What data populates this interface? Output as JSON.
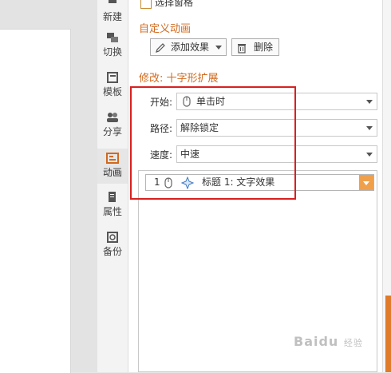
{
  "top_partial": {
    "label": "选择窗格"
  },
  "tabs": [
    {
      "id": "new",
      "label": "新建",
      "icon": "new-slide-icon"
    },
    {
      "id": "switch",
      "label": "切换",
      "icon": "transition-icon"
    },
    {
      "id": "template",
      "label": "模板",
      "icon": "template-icon"
    },
    {
      "id": "share",
      "label": "分享",
      "icon": "share-icon"
    },
    {
      "id": "animation",
      "label": "动画",
      "icon": "animation-icon",
      "active": true
    },
    {
      "id": "property",
      "label": "属性",
      "icon": "property-icon"
    },
    {
      "id": "backup",
      "label": "备份",
      "icon": "backup-icon"
    }
  ],
  "custom_animation": {
    "title": "自定义动画",
    "add_effect_label": "添加效果",
    "delete_label": "删除"
  },
  "modify": {
    "title": "修改: 十字形扩展",
    "start_label": "开始:",
    "start_value": "单击时",
    "path_label": "路径:",
    "path_value": "解除锁定",
    "speed_label": "速度:",
    "speed_value": "中速"
  },
  "animation_list": [
    {
      "index": "1",
      "name": "标题 1: 文字效果"
    }
  ],
  "watermark": {
    "brand": "Baidu",
    "sub": "经验"
  },
  "colors": {
    "accent": "#d2691e",
    "highlight": "#d92020",
    "dropdown": "#f0a04b"
  }
}
